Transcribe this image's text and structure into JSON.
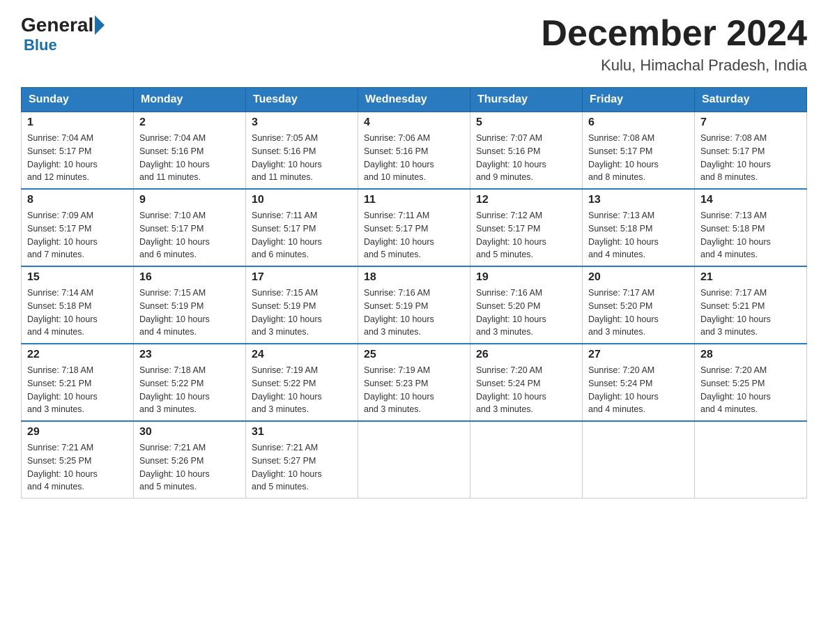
{
  "logo": {
    "general": "General",
    "blue": "Blue"
  },
  "header": {
    "title": "December 2024",
    "subtitle": "Kulu, Himachal Pradesh, India"
  },
  "days_of_week": [
    "Sunday",
    "Monday",
    "Tuesday",
    "Wednesday",
    "Thursday",
    "Friday",
    "Saturday"
  ],
  "weeks": [
    [
      {
        "day": "1",
        "sunrise": "7:04 AM",
        "sunset": "5:17 PM",
        "daylight": "10 hours and 12 minutes."
      },
      {
        "day": "2",
        "sunrise": "7:04 AM",
        "sunset": "5:16 PM",
        "daylight": "10 hours and 11 minutes."
      },
      {
        "day": "3",
        "sunrise": "7:05 AM",
        "sunset": "5:16 PM",
        "daylight": "10 hours and 11 minutes."
      },
      {
        "day": "4",
        "sunrise": "7:06 AM",
        "sunset": "5:16 PM",
        "daylight": "10 hours and 10 minutes."
      },
      {
        "day": "5",
        "sunrise": "7:07 AM",
        "sunset": "5:16 PM",
        "daylight": "10 hours and 9 minutes."
      },
      {
        "day": "6",
        "sunrise": "7:08 AM",
        "sunset": "5:17 PM",
        "daylight": "10 hours and 8 minutes."
      },
      {
        "day": "7",
        "sunrise": "7:08 AM",
        "sunset": "5:17 PM",
        "daylight": "10 hours and 8 minutes."
      }
    ],
    [
      {
        "day": "8",
        "sunrise": "7:09 AM",
        "sunset": "5:17 PM",
        "daylight": "10 hours and 7 minutes."
      },
      {
        "day": "9",
        "sunrise": "7:10 AM",
        "sunset": "5:17 PM",
        "daylight": "10 hours and 6 minutes."
      },
      {
        "day": "10",
        "sunrise": "7:11 AM",
        "sunset": "5:17 PM",
        "daylight": "10 hours and 6 minutes."
      },
      {
        "day": "11",
        "sunrise": "7:11 AM",
        "sunset": "5:17 PM",
        "daylight": "10 hours and 5 minutes."
      },
      {
        "day": "12",
        "sunrise": "7:12 AM",
        "sunset": "5:17 PM",
        "daylight": "10 hours and 5 minutes."
      },
      {
        "day": "13",
        "sunrise": "7:13 AM",
        "sunset": "5:18 PM",
        "daylight": "10 hours and 4 minutes."
      },
      {
        "day": "14",
        "sunrise": "7:13 AM",
        "sunset": "5:18 PM",
        "daylight": "10 hours and 4 minutes."
      }
    ],
    [
      {
        "day": "15",
        "sunrise": "7:14 AM",
        "sunset": "5:18 PM",
        "daylight": "10 hours and 4 minutes."
      },
      {
        "day": "16",
        "sunrise": "7:15 AM",
        "sunset": "5:19 PM",
        "daylight": "10 hours and 4 minutes."
      },
      {
        "day": "17",
        "sunrise": "7:15 AM",
        "sunset": "5:19 PM",
        "daylight": "10 hours and 3 minutes."
      },
      {
        "day": "18",
        "sunrise": "7:16 AM",
        "sunset": "5:19 PM",
        "daylight": "10 hours and 3 minutes."
      },
      {
        "day": "19",
        "sunrise": "7:16 AM",
        "sunset": "5:20 PM",
        "daylight": "10 hours and 3 minutes."
      },
      {
        "day": "20",
        "sunrise": "7:17 AM",
        "sunset": "5:20 PM",
        "daylight": "10 hours and 3 minutes."
      },
      {
        "day": "21",
        "sunrise": "7:17 AM",
        "sunset": "5:21 PM",
        "daylight": "10 hours and 3 minutes."
      }
    ],
    [
      {
        "day": "22",
        "sunrise": "7:18 AM",
        "sunset": "5:21 PM",
        "daylight": "10 hours and 3 minutes."
      },
      {
        "day": "23",
        "sunrise": "7:18 AM",
        "sunset": "5:22 PM",
        "daylight": "10 hours and 3 minutes."
      },
      {
        "day": "24",
        "sunrise": "7:19 AM",
        "sunset": "5:22 PM",
        "daylight": "10 hours and 3 minutes."
      },
      {
        "day": "25",
        "sunrise": "7:19 AM",
        "sunset": "5:23 PM",
        "daylight": "10 hours and 3 minutes."
      },
      {
        "day": "26",
        "sunrise": "7:20 AM",
        "sunset": "5:24 PM",
        "daylight": "10 hours and 3 minutes."
      },
      {
        "day": "27",
        "sunrise": "7:20 AM",
        "sunset": "5:24 PM",
        "daylight": "10 hours and 4 minutes."
      },
      {
        "day": "28",
        "sunrise": "7:20 AM",
        "sunset": "5:25 PM",
        "daylight": "10 hours and 4 minutes."
      }
    ],
    [
      {
        "day": "29",
        "sunrise": "7:21 AM",
        "sunset": "5:25 PM",
        "daylight": "10 hours and 4 minutes."
      },
      {
        "day": "30",
        "sunrise": "7:21 AM",
        "sunset": "5:26 PM",
        "daylight": "10 hours and 5 minutes."
      },
      {
        "day": "31",
        "sunrise": "7:21 AM",
        "sunset": "5:27 PM",
        "daylight": "10 hours and 5 minutes."
      },
      null,
      null,
      null,
      null
    ]
  ],
  "labels": {
    "sunrise": "Sunrise:",
    "sunset": "Sunset:",
    "daylight": "Daylight:"
  }
}
